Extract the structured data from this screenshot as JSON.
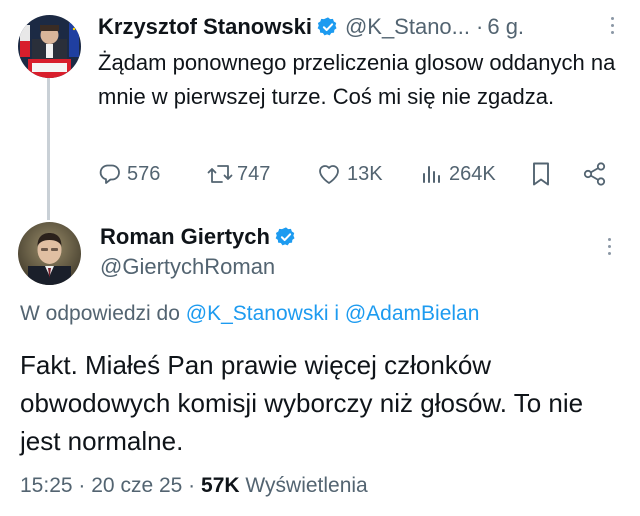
{
  "parent_tweet": {
    "author_name": "Krzysztof Stanowski",
    "author_handle": "@K_Stano...",
    "separator": "·",
    "time_ago": "6 g.",
    "text": "Żądam ponownego przeliczenia glosow oddanych na mnie w pierwszej turze. Coś mi się nie zgadza.",
    "avatar_icon": "portrait-with-flags-avatar",
    "actions": {
      "replies": "576",
      "reposts": "747",
      "likes": "13K",
      "views": "264K"
    }
  },
  "reply_tweet": {
    "author_name": "Roman Giertych",
    "author_handle": "@GiertychRoman",
    "avatar_icon": "portrait-avatar",
    "in_reply_to_prefix": "W odpowiedzi do",
    "in_reply_to_user1": "@K_Stanowski",
    "in_reply_to_and": "i",
    "in_reply_to_user2": "@AdamBielan",
    "text": "Fakt. Miałeś Pan prawie  więcej członków obwodowych komisji wyborczy niż głosów. To nie jest normalne.",
    "time": "15:25",
    "separator1": "·",
    "date": "20 cze 25",
    "separator2": "·",
    "views_count": "57K",
    "views_label": "Wyświetlenia"
  },
  "colors": {
    "verified": "#1d9bf0",
    "link": "#1d9bf0",
    "muted": "#536471",
    "text": "#0f1419"
  }
}
